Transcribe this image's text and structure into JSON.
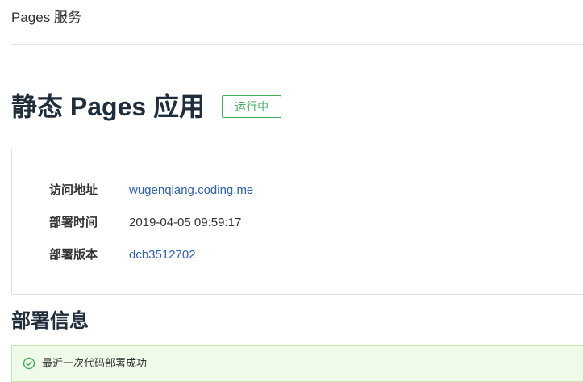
{
  "header": {
    "breadcrumb_title": "Pages 服务"
  },
  "main": {
    "title": "静态 Pages 应用",
    "status": "运行中",
    "info": {
      "rows": [
        {
          "label": "访问地址",
          "value": "wugenqiang.coding.me"
        },
        {
          "label": "部署时间",
          "value": "2019-04-05 09:59:17"
        },
        {
          "label": "部署版本",
          "value": "dcb3512702"
        }
      ]
    },
    "deploy_section": {
      "title": "部署信息",
      "alert_text": "最近一次代码部署成功"
    }
  },
  "colors": {
    "status_green": "#3fae5f",
    "link_blue": "#2e61b9",
    "alert_bg": "#f0fae8"
  },
  "icons": {
    "alert_icon": "check-circle-icon"
  }
}
